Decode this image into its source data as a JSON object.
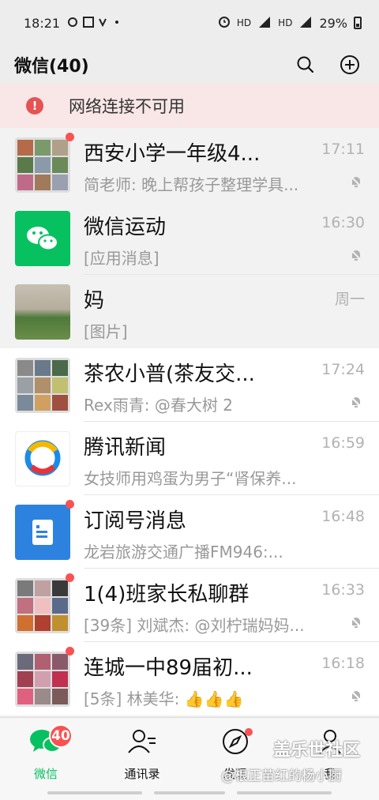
{
  "status_bar": {
    "time": "18:21",
    "net1": "HD",
    "net2": "HD",
    "battery": "29%"
  },
  "header": {
    "title": "微信(40)"
  },
  "network_banner": {
    "icon": "warning-icon",
    "text": "网络连接不可用"
  },
  "chats": [
    {
      "name": "西安小学一年级4...",
      "time": "17:11",
      "preview": "简老师: 晚上帮孩子整理学具...",
      "muted": true,
      "unread_dot": true,
      "pinned": true,
      "avatar": "group-avatar"
    },
    {
      "name": "微信运动",
      "time": "16:30",
      "preview": "[应用消息]",
      "muted": true,
      "unread_dot": false,
      "pinned": true,
      "avatar": "wechat-sport-avatar"
    },
    {
      "name": "妈",
      "time": "周一",
      "preview": "[图片]",
      "muted": false,
      "unread_dot": false,
      "pinned": true,
      "avatar": "photo-avatar"
    },
    {
      "name": "茶农小普(茶友交...",
      "time": "17:24",
      "preview": "Rex雨青: @春大树 2",
      "muted": true,
      "unread_dot": false,
      "pinned": false,
      "avatar": "group-avatar"
    },
    {
      "name": "腾讯新闻",
      "time": "16:59",
      "preview": "女技师用鸡蛋为男子“肾保养...",
      "muted": false,
      "unread_dot": false,
      "pinned": false,
      "avatar": "tencent-news-avatar"
    },
    {
      "name": "订阅号消息",
      "time": "16:48",
      "preview": "龙岩旅游交通广播FM946:...",
      "muted": false,
      "unread_dot": true,
      "pinned": false,
      "avatar": "subscription-avatar"
    },
    {
      "name": "1(4)班家长私聊群",
      "time": "16:33",
      "preview": "[39条] 刘斌杰: @刘柠瑞妈妈...",
      "muted": true,
      "unread_dot": true,
      "pinned": false,
      "avatar": "group-avatar"
    },
    {
      "name": "连城一中89届初...",
      "time": "16:18",
      "preview": "[5条] 林美华: 👍👍👍",
      "muted": true,
      "unread_dot": true,
      "pinned": false,
      "avatar": "group-avatar"
    }
  ],
  "tabs": [
    {
      "label": "微信",
      "badge": "40",
      "active": true,
      "icon": "chat-bubbles-icon"
    },
    {
      "label": "通讯录",
      "active": false,
      "icon": "contacts-icon"
    },
    {
      "label": "发现",
      "active": false,
      "icon": "compass-icon",
      "dot": true
    },
    {
      "label": "我",
      "active": false,
      "icon": "person-icon"
    }
  ],
  "watermark": {
    "line1": "盖乐世社区",
    "line2": "@根正苗红的杨小厨"
  },
  "colors": {
    "accent_green": "#07c160",
    "badge_red": "#fa5151",
    "banner_bg": "#f9e6e6"
  }
}
